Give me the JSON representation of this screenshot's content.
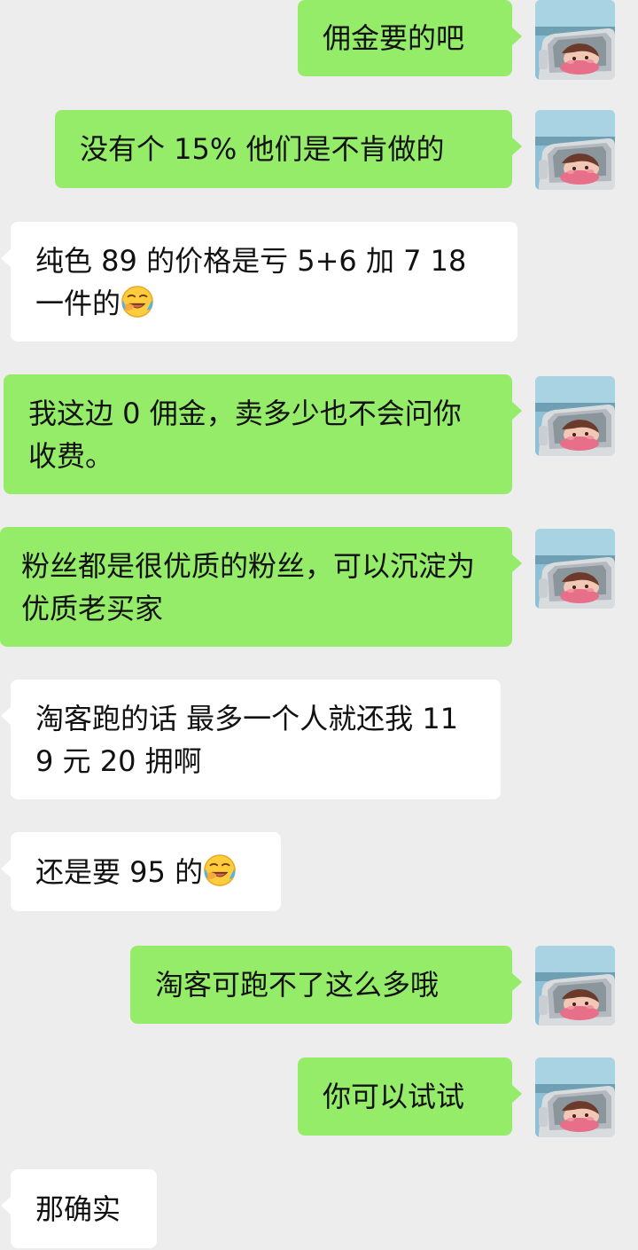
{
  "messages": [
    {
      "side": "sent",
      "text": "佣金要的吧"
    },
    {
      "side": "sent",
      "text": "没有个 15% 他们是不肯做的"
    },
    {
      "side": "recv",
      "text": "纯色 89 的价格是亏 5+6 加 7 18 一件的",
      "emoji": "crying-laughing-emoji"
    },
    {
      "side": "sent",
      "text": "我这边 0 佣金，卖多少也不会问你收费。"
    },
    {
      "side": "sent",
      "text": "粉丝都是很优质的粉丝，可以沉淀为优质老买家"
    },
    {
      "side": "recv",
      "text": "淘客跑的话 最多一个人就还我 119 元 20 拥啊"
    },
    {
      "side": "recv",
      "text": "还是要 95 的",
      "emoji": "crying-laughing-emoji"
    },
    {
      "side": "sent",
      "text": "淘客可跑不了这么多哦"
    },
    {
      "side": "sent",
      "text": "你可以试试"
    },
    {
      "side": "recv",
      "text": "那确实"
    }
  ],
  "avatar_icon": "user-avatar-car-girl-icon",
  "colors": {
    "background": "#ededed",
    "sent_bubble": "#95ec69",
    "received_bubble": "#ffffff",
    "text": "#111111"
  }
}
